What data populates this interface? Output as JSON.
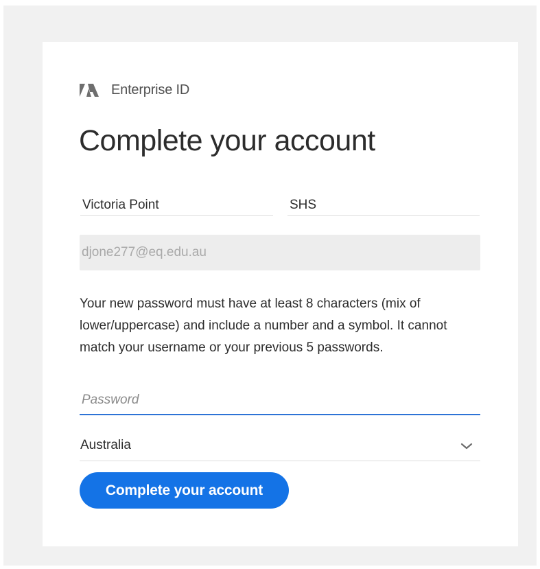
{
  "brand": {
    "logo_icon": "adobe-logo-icon",
    "text": "Enterprise ID"
  },
  "title": "Complete your account",
  "form": {
    "first_name": "Victoria Point",
    "last_name": "SHS",
    "email": "djone277@eq.edu.au",
    "hint": "Your new password must have at least 8 characters (mix of lower/uppercase) and include a number and a symbol. It cannot match your username or your previous 5 passwords.",
    "password_placeholder": "Password",
    "country": "Australia",
    "submit_label": "Complete your account"
  },
  "colors": {
    "accent": "#1473e6",
    "focus_underline": "#2d73d6",
    "page_background": "#f1f1f1"
  }
}
